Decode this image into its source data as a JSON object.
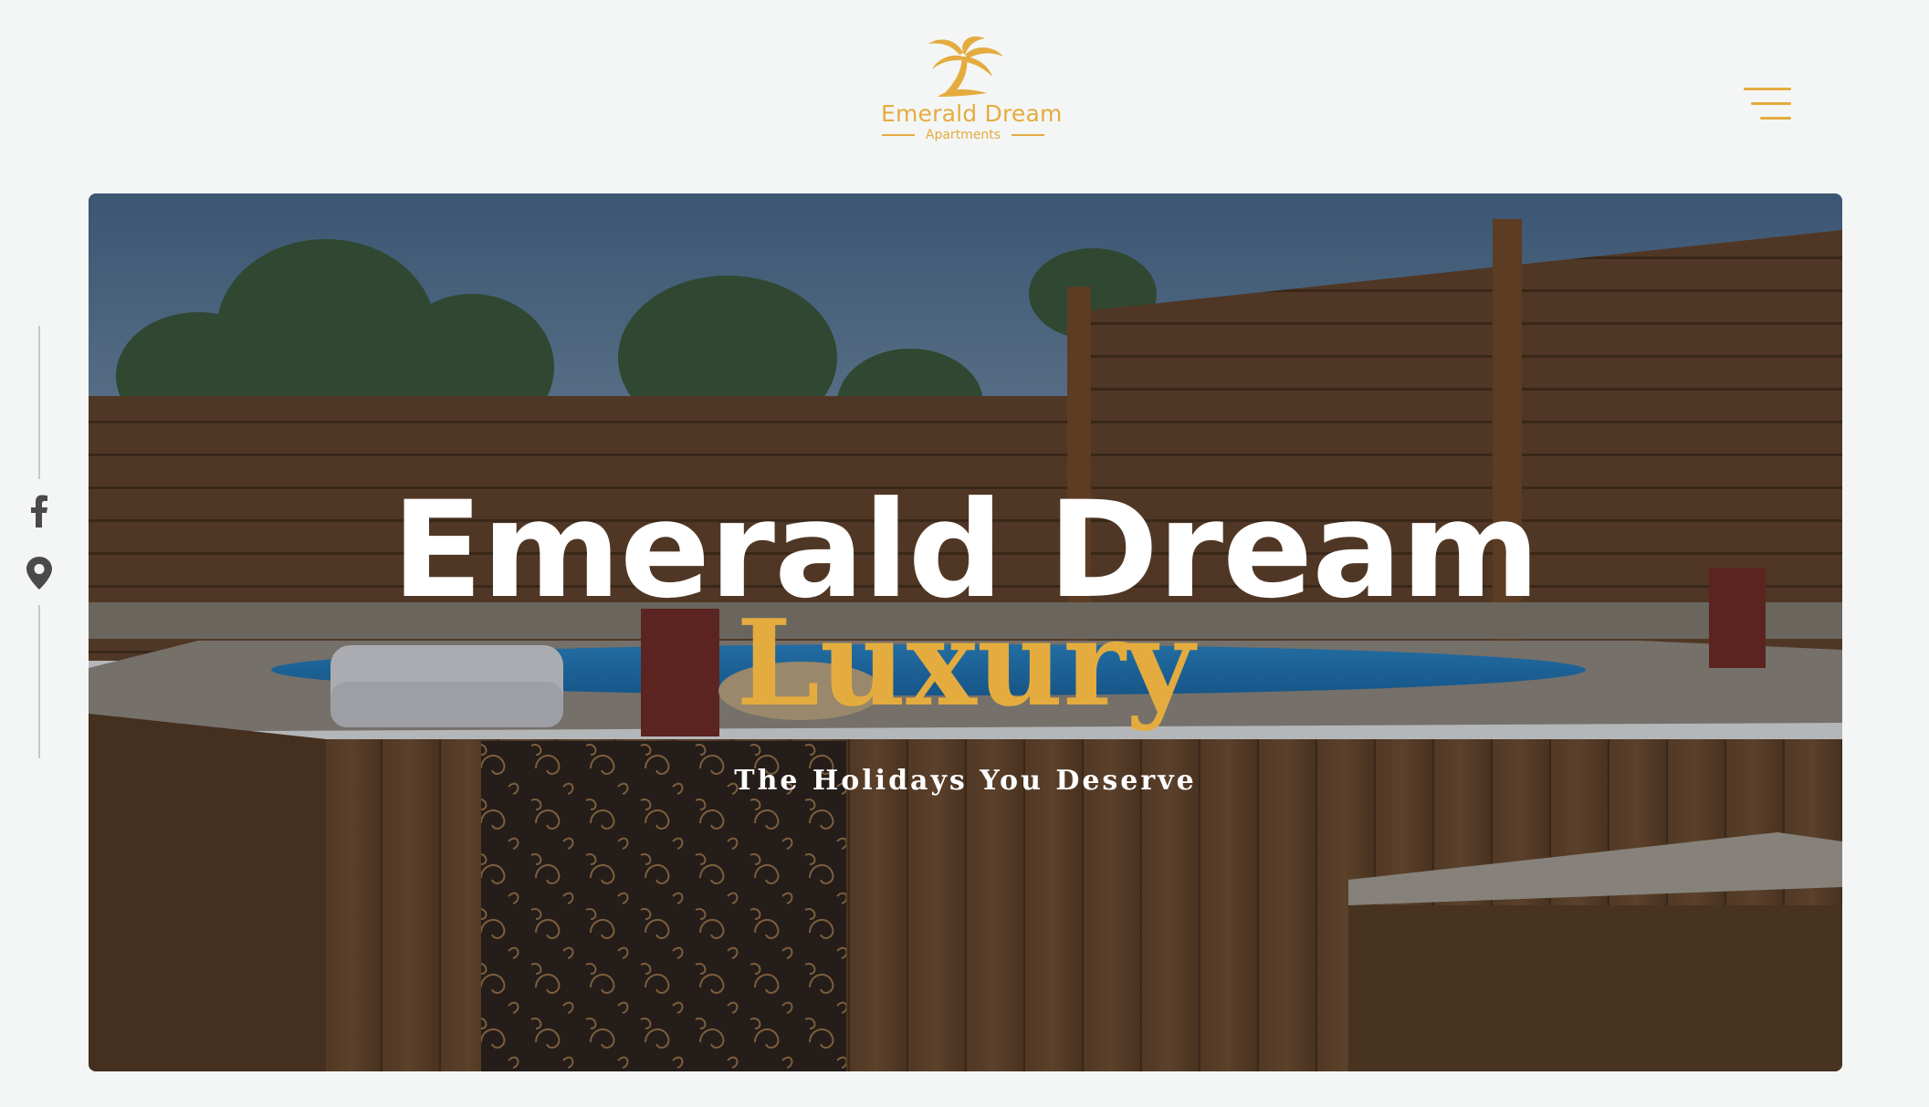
{
  "brand": {
    "name": "Emerald Dream",
    "subtitle": "Apartments",
    "logo_icon": "palm-tree-icon",
    "accent_color": "#e4ac3f"
  },
  "header": {
    "menu_icon": "hamburger-menu-icon"
  },
  "social": [
    {
      "name": "facebook",
      "icon": "facebook-icon"
    },
    {
      "name": "location",
      "icon": "map-pin-icon"
    }
  ],
  "hero": {
    "title": "Emerald Dream",
    "subtitle": "Luxury",
    "tagline": "The Holidays You Deserve",
    "image": "hot-tub-on-wooden-deck"
  }
}
